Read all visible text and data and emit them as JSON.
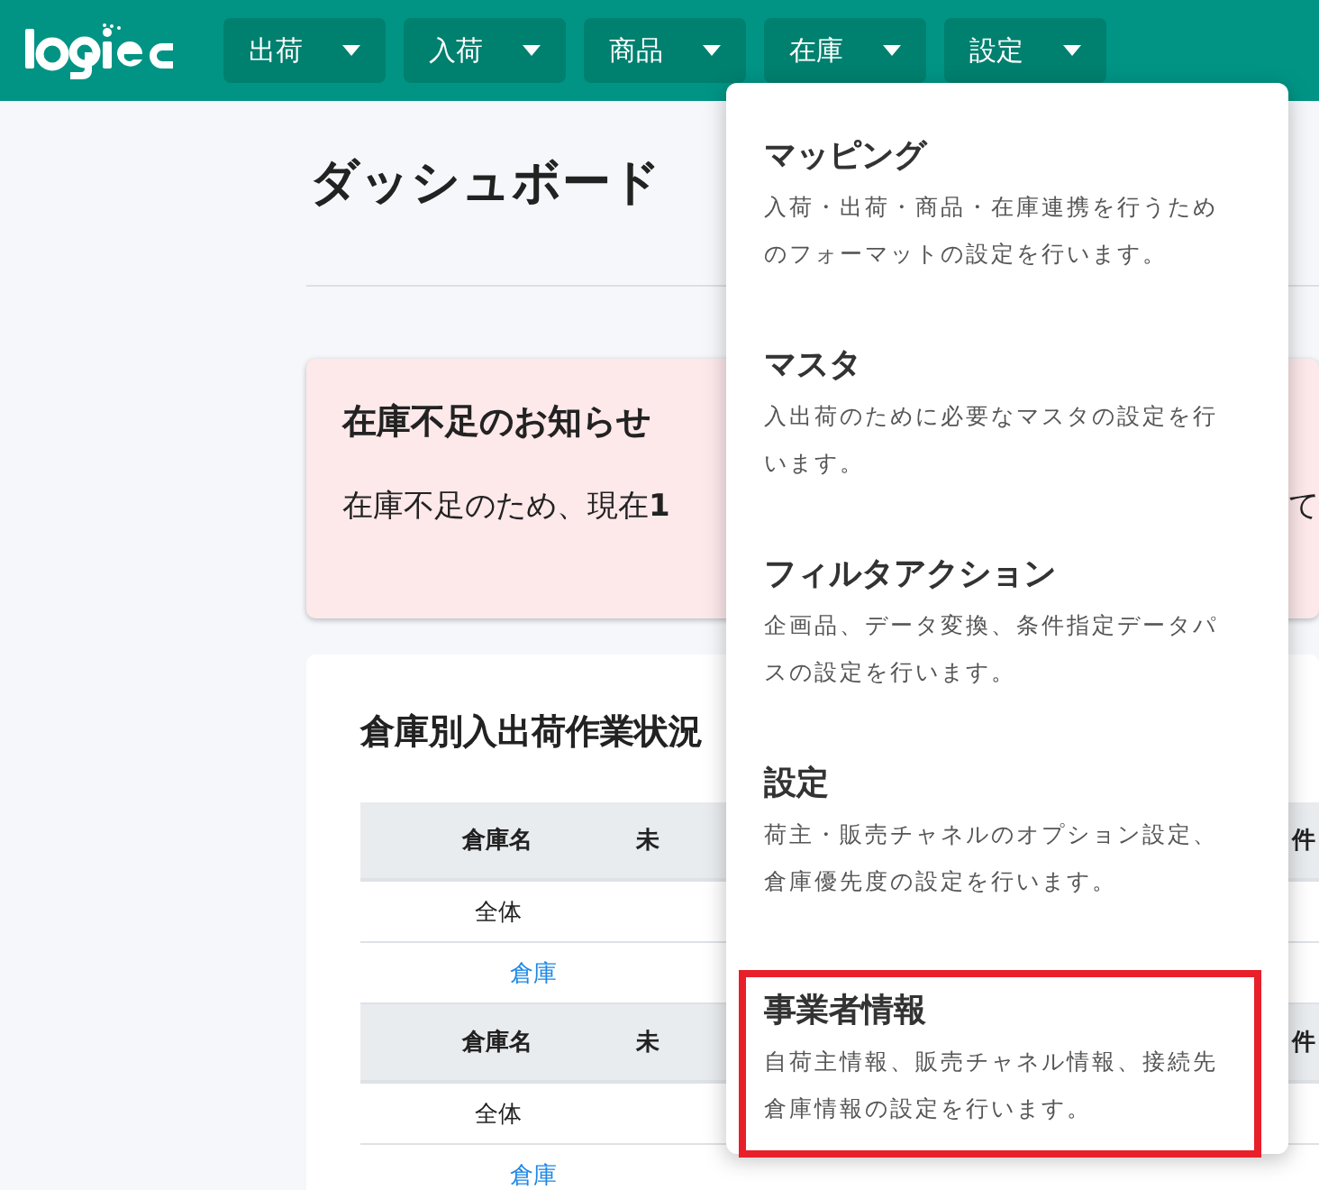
{
  "nav": [
    {
      "label": "出荷"
    },
    {
      "label": "入荷"
    },
    {
      "label": "商品"
    },
    {
      "label": "在庫"
    },
    {
      "label": "設定"
    }
  ],
  "page_title": "ダッシュボード",
  "notice": {
    "title": "在庫不足のお知らせ",
    "body_start": "在庫不足のため、現在**1**",
    "body_end": "て"
  },
  "status_card": {
    "title": "倉庫別入出荷作業状況",
    "tables": [
      {
        "columns": [
          "倉庫名",
          "未",
          "件"
        ],
        "rows": [
          {
            "cells": [
              "全体"
            ]
          },
          {
            "link": "倉庫"
          }
        ]
      },
      {
        "columns": [
          "倉庫名",
          "未",
          "件"
        ],
        "rows": [
          {
            "cells": [
              "全体"
            ]
          },
          {
            "link": "倉庫"
          }
        ]
      }
    ]
  },
  "menu": {
    "items": [
      {
        "title": "マッピング",
        "description": "入荷・出荷・商品・在庫連携を行うためのフォーマットの設定を行います。",
        "highlighted": false
      },
      {
        "title": "マスタ",
        "description": "入出荷のために必要なマスタの設定を行います。",
        "highlighted": false
      },
      {
        "title": "フィルタアクション",
        "description": "企画品、データ変換、条件指定データパスの設定を行います。",
        "highlighted": false
      },
      {
        "title": "設定",
        "description": "荷主・販売チャネルのオプション設定、倉庫優先度の設定を行います。",
        "highlighted": false
      },
      {
        "title": "事業者情報",
        "description": "自荷主情報、販売チャネル情報、接続先倉庫情報の設定を行います。",
        "highlighted": true
      }
    ]
  }
}
